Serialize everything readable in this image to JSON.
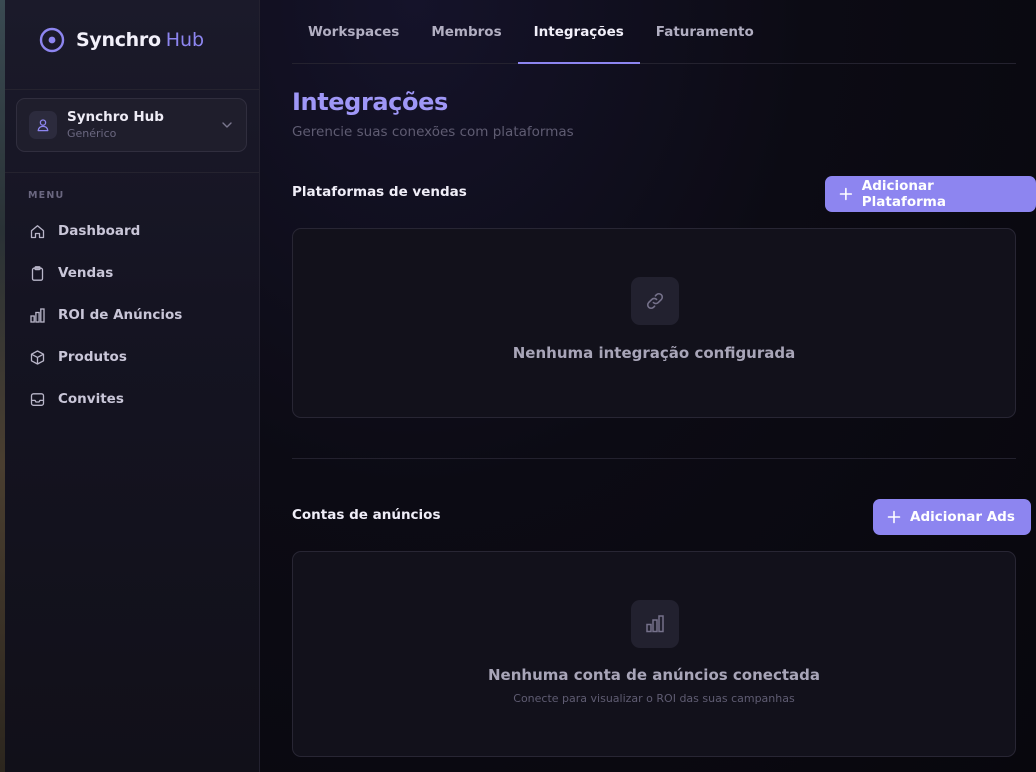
{
  "colors": {
    "accent": "#8d85f0",
    "title_accent": "#9f97f7",
    "sidebar_bg": "#151422",
    "card_bg": "#12111b"
  },
  "brand": {
    "name": "Synchro",
    "suffix": "Hub",
    "logo_icon": "target-ring-icon"
  },
  "workspace": {
    "name": "Synchro Hub",
    "type": "Genérico",
    "avatar_icon": "user-icon",
    "chevron_icon": "chevron-down-icon"
  },
  "sidebar": {
    "section_label": "MENU",
    "items": [
      {
        "label": "Dashboard",
        "icon": "home-icon"
      },
      {
        "label": "Vendas",
        "icon": "clipboard-icon"
      },
      {
        "label": "ROI de Anúncios",
        "icon": "bar-chart-icon"
      },
      {
        "label": "Produtos",
        "icon": "box-icon"
      },
      {
        "label": "Convites",
        "icon": "inbox-icon"
      }
    ]
  },
  "tabs": [
    {
      "label": "Workspaces",
      "active": false
    },
    {
      "label": "Membros",
      "active": false
    },
    {
      "label": "Integrações",
      "active": true
    },
    {
      "label": "Faturamento",
      "active": false
    }
  ],
  "page": {
    "title": "Integrações",
    "subtitle": "Gerencie suas conexões com plataformas"
  },
  "sales_platforms": {
    "title": "Plataformas de vendas",
    "add_button": "Adicionar Plataforma",
    "empty_icon": "link-icon",
    "empty_title": "Nenhuma integração configurada"
  },
  "ad_accounts": {
    "title": "Contas de anúncios",
    "add_button": "Adicionar Ads",
    "empty_icon": "bar-chart-icon",
    "empty_title": "Nenhuma conta de anúncios conectada",
    "empty_subtitle": "Conecte para visualizar o ROI das suas campanhas"
  }
}
